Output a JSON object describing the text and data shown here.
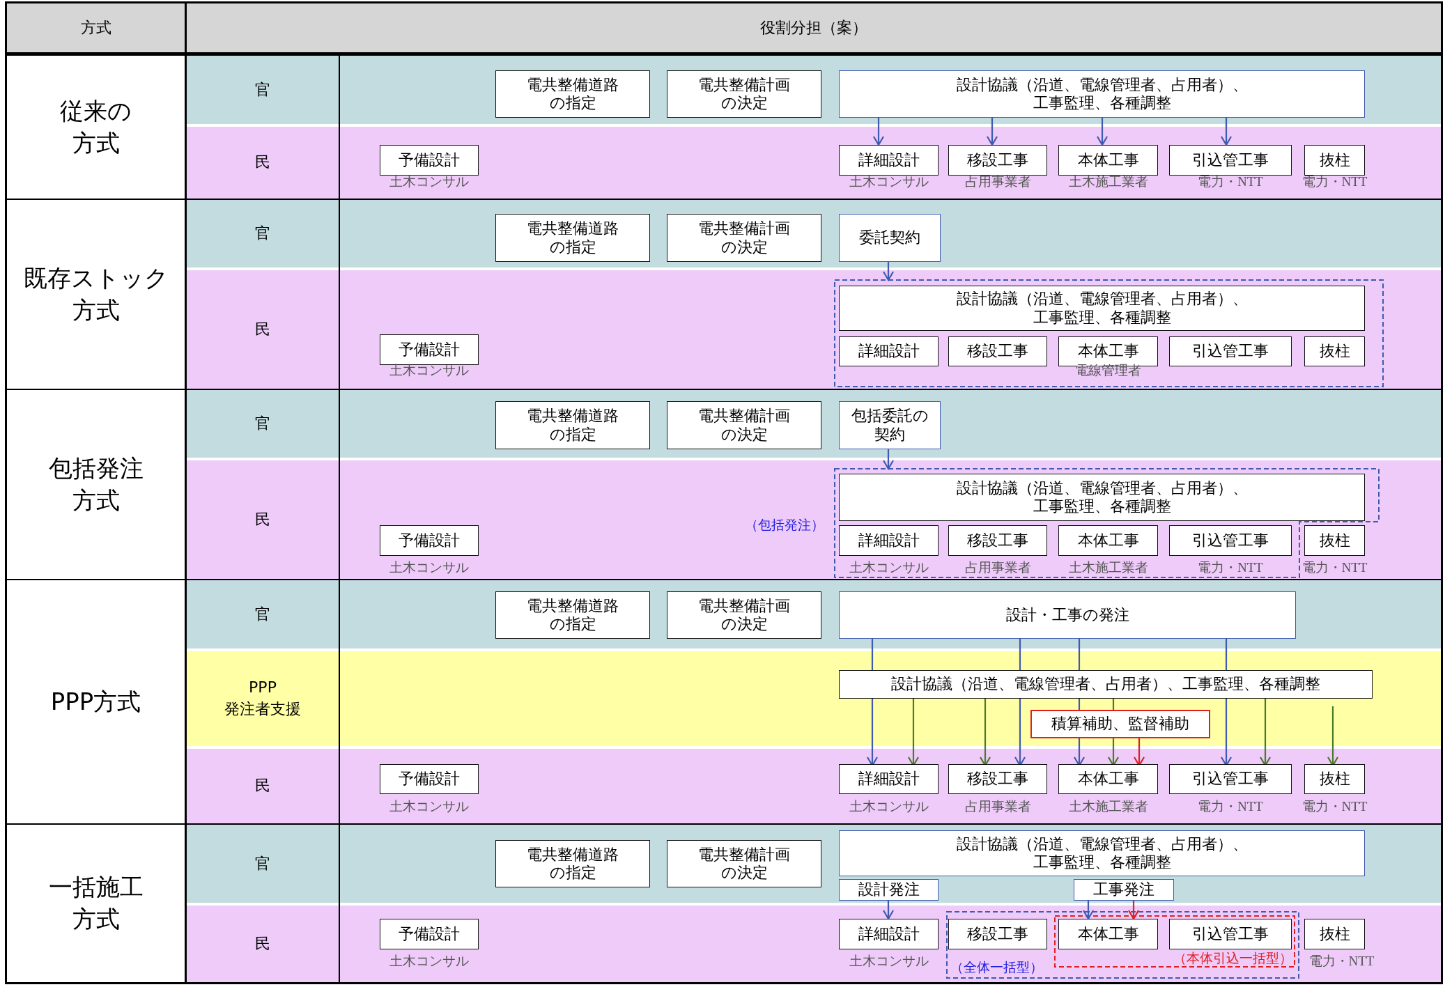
{
  "header": {
    "method": "方式",
    "roles": "役割分担（案）"
  },
  "methods": [
    {
      "name": "従来の方式",
      "rows": [
        {
          "role": "官",
          "kind": "gov",
          "items": [
            {
              "kind": "task",
              "text": "電共整備道路の指定"
            },
            {
              "kind": "task",
              "text": "電共整備計画の決定"
            },
            {
              "kind": "order",
              "text": "設計協議（沿道、電線管理者、占用者）、工事監理、各種調整"
            }
          ]
        },
        {
          "role": "民",
          "kind": "private",
          "items": [
            {
              "kind": "task",
              "text": "予備設計"
            },
            {
              "kind": "task",
              "text": "詳細設計"
            },
            {
              "kind": "task",
              "text": "移設工事"
            },
            {
              "kind": "task",
              "text": "本体工事"
            },
            {
              "kind": "task",
              "text": "引込管工事"
            },
            {
              "kind": "task",
              "text": "抜柱"
            },
            {
              "kind": "caption",
              "text": "土木コンサル"
            },
            {
              "kind": "caption",
              "text": "土木コンサル"
            },
            {
              "kind": "caption",
              "text": "占用事業者"
            },
            {
              "kind": "caption",
              "text": "土木施工業者"
            },
            {
              "kind": "caption",
              "text": "電力・NTT"
            },
            {
              "kind": "caption",
              "text": "電力・NTT"
            }
          ]
        }
      ]
    },
    {
      "name": "既存ストック方式",
      "rows": [
        {
          "role": "官",
          "kind": "gov",
          "items": [
            {
              "kind": "task",
              "text": "電共整備道路の指定"
            },
            {
              "kind": "task",
              "text": "電共整備計画の決定"
            },
            {
              "kind": "order",
              "text": "委託契約"
            }
          ]
        },
        {
          "role": "民",
          "kind": "private",
          "items": [
            {
              "kind": "task",
              "text": "設計協議（沿道、電線管理者、占用者）、工事監理、各種調整"
            },
            {
              "kind": "task",
              "text": "予備設計"
            },
            {
              "kind": "task",
              "text": "詳細設計"
            },
            {
              "kind": "task",
              "text": "移設工事"
            },
            {
              "kind": "task",
              "text": "本体工事"
            },
            {
              "kind": "task",
              "text": "引込管工事"
            },
            {
              "kind": "task",
              "text": "抜柱"
            },
            {
              "kind": "caption",
              "text": "土木コンサル"
            },
            {
              "kind": "caption",
              "text": "電線管理者"
            }
          ]
        }
      ]
    },
    {
      "name": "包括発注方式",
      "rows": [
        {
          "role": "官",
          "kind": "gov",
          "items": [
            {
              "kind": "task",
              "text": "電共整備道路の指定"
            },
            {
              "kind": "task",
              "text": "電共整備計画の決定"
            },
            {
              "kind": "order",
              "text": "包括委託の契約"
            }
          ]
        },
        {
          "role": "民",
          "kind": "private",
          "items": [
            {
              "kind": "task",
              "text": "設計協議（沿道、電線管理者、占用者）、工事監理、各種調整"
            },
            {
              "kind": "note",
              "text": "（包括発注）",
              "color": "#2020e0"
            },
            {
              "kind": "task",
              "text": "予備設計"
            },
            {
              "kind": "task",
              "text": "詳細設計"
            },
            {
              "kind": "task",
              "text": "移設工事"
            },
            {
              "kind": "task",
              "text": "本体工事"
            },
            {
              "kind": "task",
              "text": "引込管工事"
            },
            {
              "kind": "task",
              "text": "抜柱"
            },
            {
              "kind": "caption",
              "text": "土木コンサル"
            },
            {
              "kind": "caption",
              "text": "土木コンサル"
            },
            {
              "kind": "caption",
              "text": "占用事業者"
            },
            {
              "kind": "caption",
              "text": "土木施工業者"
            },
            {
              "kind": "caption",
              "text": "電力・NTT"
            },
            {
              "kind": "caption",
              "text": "電力・NTT"
            }
          ]
        }
      ]
    },
    {
      "name": "PPP方式",
      "rows": [
        {
          "role": "官",
          "kind": "gov",
          "items": [
            {
              "kind": "task",
              "text": "電共整備道路の指定"
            },
            {
              "kind": "task",
              "text": "電共整備計画の決定"
            },
            {
              "kind": "order",
              "text": "設計・工事の発注"
            }
          ]
        },
        {
          "role": "PPP\n発注者支援",
          "kind": "support",
          "items": [
            {
              "kind": "task",
              "text": "設計協議（沿道、電線管理者、占用者）、工事監理、各種調整"
            },
            {
              "kind": "support",
              "text": "積算補助、監督補助"
            }
          ]
        },
        {
          "role": "民",
          "kind": "private",
          "items": [
            {
              "kind": "task",
              "text": "予備設計"
            },
            {
              "kind": "task",
              "text": "詳細設計"
            },
            {
              "kind": "task",
              "text": "移設工事"
            },
            {
              "kind": "task",
              "text": "本体工事"
            },
            {
              "kind": "task",
              "text": "引込管工事"
            },
            {
              "kind": "task",
              "text": "抜柱"
            },
            {
              "kind": "caption",
              "text": "土木コンサル"
            },
            {
              "kind": "caption",
              "text": "土木コンサル"
            },
            {
              "kind": "caption",
              "text": "占用事業者"
            },
            {
              "kind": "caption",
              "text": "土木施工業者"
            },
            {
              "kind": "caption",
              "text": "電力・NTT"
            },
            {
              "kind": "caption",
              "text": "電力・NTT"
            }
          ]
        }
      ]
    },
    {
      "name": "一括施工方式",
      "rows": [
        {
          "role": "官",
          "kind": "gov",
          "items": [
            {
              "kind": "task",
              "text": "電共整備道路の指定"
            },
            {
              "kind": "task",
              "text": "電共整備計画の決定"
            },
            {
              "kind": "order",
              "text": "設計協議（沿道、電線管理者、占用者）、工事監理、各種調整"
            },
            {
              "kind": "order",
              "text": "設計発注"
            },
            {
              "kind": "order",
              "text": "工事発注"
            }
          ]
        },
        {
          "role": "民",
          "kind": "private",
          "items": [
            {
              "kind": "task",
              "text": "予備設計"
            },
            {
              "kind": "task",
              "text": "詳細設計"
            },
            {
              "kind": "task",
              "text": "移設工事"
            },
            {
              "kind": "task",
              "text": "本体工事"
            },
            {
              "kind": "task",
              "text": "引込管工事"
            },
            {
              "kind": "task",
              "text": "抜柱"
            },
            {
              "kind": "caption",
              "text": "土木コンサル"
            },
            {
              "kind": "caption",
              "text": "土木コンサル"
            },
            {
              "kind": "note",
              "text": "（全体一括型）",
              "color": "#2020e0"
            },
            {
              "kind": "note",
              "text": "（本体引込一括型）",
              "color": "#e02020"
            },
            {
              "kind": "caption",
              "text": "電力・NTT"
            }
          ]
        }
      ]
    }
  ]
}
